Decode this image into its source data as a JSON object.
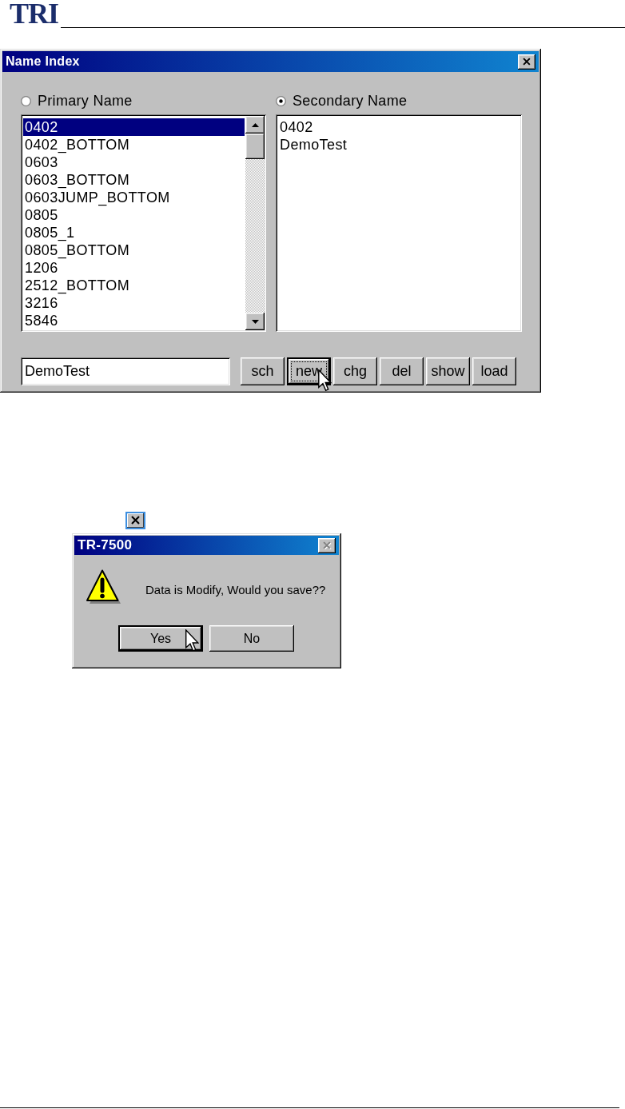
{
  "header": {
    "logo": "TRI"
  },
  "name_index_window": {
    "title": "Name Index",
    "close_button": {
      "disabled": false
    },
    "radios": [
      {
        "label": "Primary Name",
        "selected": false
      },
      {
        "label": "Secondary Name",
        "selected": true
      }
    ],
    "primary_list": {
      "items": [
        {
          "text": "0402",
          "selected": true
        },
        {
          "text": "0402_BOTTOM",
          "selected": false
        },
        {
          "text": "0603",
          "selected": false
        },
        {
          "text": "0603_BOTTOM",
          "selected": false
        },
        {
          "text": "0603JUMP_BOTTOM",
          "selected": false
        },
        {
          "text": "0805",
          "selected": false
        },
        {
          "text": "0805_1",
          "selected": false
        },
        {
          "text": "0805_BOTTOM",
          "selected": false
        },
        {
          "text": "1206",
          "selected": false
        },
        {
          "text": "2512_BOTTOM",
          "selected": false
        },
        {
          "text": "3216",
          "selected": false
        },
        {
          "text": "5846",
          "selected": false
        }
      ]
    },
    "secondary_list": {
      "items": [
        {
          "text": "0402",
          "selected": false
        },
        {
          "text": "DemoTest",
          "selected": false
        }
      ]
    },
    "name_field": {
      "value": "DemoTest"
    },
    "buttons": [
      {
        "label": "sch",
        "focused": false,
        "hovered": false
      },
      {
        "label": "new",
        "focused": true,
        "hovered": true
      },
      {
        "label": "chg",
        "focused": false,
        "hovered": false
      },
      {
        "label": "del",
        "focused": false,
        "hovered": false
      },
      {
        "label": "show",
        "focused": false,
        "hovered": false
      },
      {
        "label": "load",
        "focused": false,
        "hovered": false
      }
    ]
  },
  "message_dialog": {
    "title": "TR-7500",
    "close_button": {
      "disabled": true
    },
    "message": "Data is Modify, Would you save??",
    "buttons": [
      {
        "label": "Yes",
        "default": true,
        "hovered": true
      },
      {
        "label": "No",
        "default": false,
        "hovered": false
      }
    ]
  }
}
